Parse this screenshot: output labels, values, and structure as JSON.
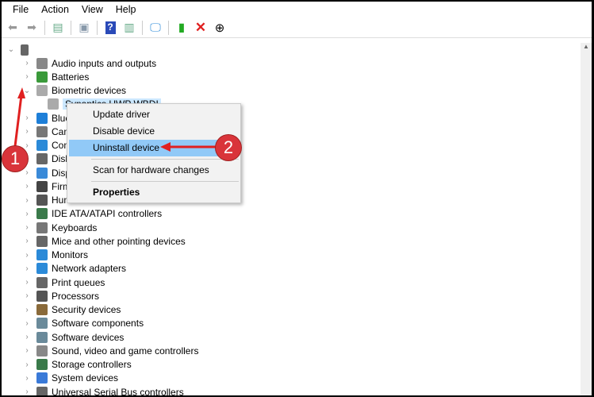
{
  "menubar": [
    "File",
    "Action",
    "View",
    "Help"
  ],
  "toolbar": [
    "back-icon",
    "forward-icon",
    "show-hide-console-icon",
    "properties-icon",
    "help-icon",
    "action-pane-icon",
    "scan-monitor-icon",
    "update-driver-icon",
    "uninstall-icon",
    "disable-icon"
  ],
  "tree": {
    "items": [
      {
        "label": "Audio inputs and outputs",
        "icon": "speaker-icon",
        "color": "#888"
      },
      {
        "label": "Batteries",
        "icon": "battery-icon",
        "color": "#3a9a3a"
      },
      {
        "label": "Biometric devices",
        "icon": "fingerprint-icon",
        "color": "#aaa",
        "expanded": true
      },
      {
        "label": "Synaptics UWP WBDI",
        "icon": "fingerprint-icon",
        "color": "#aaa",
        "child": true,
        "selected": true
      },
      {
        "label": "Bluetooth",
        "icon": "bluetooth-icon",
        "color": "#1e7fd8"
      },
      {
        "label": "Cameras",
        "icon": "camera-icon",
        "color": "#777"
      },
      {
        "label": "Computer",
        "icon": "monitor-icon",
        "color": "#2b8ad8"
      },
      {
        "label": "Disk drives",
        "icon": "disk-icon",
        "color": "#666"
      },
      {
        "label": "Display adapters",
        "icon": "display-icon",
        "color": "#3a8ad8"
      },
      {
        "label": "Firmware",
        "icon": "chip-icon",
        "color": "#444"
      },
      {
        "label": "Human Interface Devices",
        "icon": "hid-icon",
        "color": "#555"
      },
      {
        "label": "IDE ATA/ATAPI controllers",
        "icon": "ide-icon",
        "color": "#3a7a4a"
      },
      {
        "label": "Keyboards",
        "icon": "keyboard-icon",
        "color": "#777"
      },
      {
        "label": "Mice and other pointing devices",
        "icon": "mouse-icon",
        "color": "#666"
      },
      {
        "label": "Monitors",
        "icon": "monitor-icon",
        "color": "#2b8ad8"
      },
      {
        "label": "Network adapters",
        "icon": "network-icon",
        "color": "#2b8ad8"
      },
      {
        "label": "Print queues",
        "icon": "printer-icon",
        "color": "#666"
      },
      {
        "label": "Processors",
        "icon": "cpu-icon",
        "color": "#555"
      },
      {
        "label": "Security devices",
        "icon": "security-icon",
        "color": "#8a6a3a"
      },
      {
        "label": "Software components",
        "icon": "component-icon",
        "color": "#6a8a9a"
      },
      {
        "label": "Software devices",
        "icon": "software-icon",
        "color": "#6a8a9a"
      },
      {
        "label": "Sound, video and game controllers",
        "icon": "speaker-icon",
        "color": "#888"
      },
      {
        "label": "Storage controllers",
        "icon": "storage-icon",
        "color": "#3a7a4a"
      },
      {
        "label": "System devices",
        "icon": "system-icon",
        "color": "#3a7ad8"
      },
      {
        "label": "Universal Serial Bus controllers",
        "icon": "usb-icon",
        "color": "#666"
      }
    ]
  },
  "context_menu": {
    "items": [
      "Update driver",
      "Disable device",
      "Uninstall device",
      "Scan for hardware changes",
      "Properties"
    ],
    "highlighted": "Uninstall device"
  },
  "annotations": {
    "step1": "1",
    "step2": "2",
    "color": "#d9343a"
  }
}
